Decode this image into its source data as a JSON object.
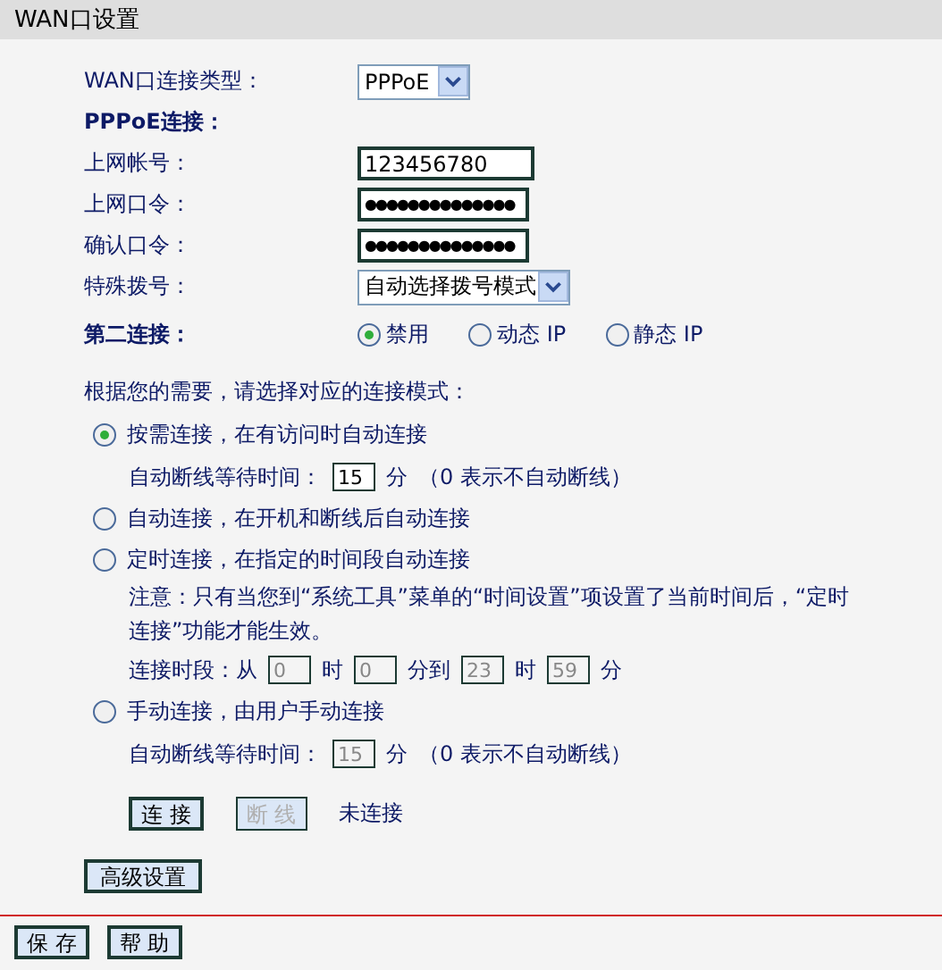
{
  "title": "WAN口设置",
  "fields": [
    {
      "kind": "select",
      "label": "WAN口连接类型：",
      "value": "PPPoE"
    },
    {
      "kind": "heading",
      "label": "PPPoE连接："
    },
    {
      "kind": "text",
      "label": "上网帐号：",
      "value": "123456780"
    },
    {
      "kind": "text",
      "label": "上网口令：",
      "value": "●●●●●●●●●●●●●●"
    },
    {
      "kind": "text",
      "label": "确认口令：",
      "value": "●●●●●●●●●●●●●●"
    },
    {
      "kind": "wideselect",
      "label": "特殊拨号：",
      "value": "自动选择拨号模式"
    }
  ],
  "second": {
    "label": "第二连接：",
    "options": [
      {
        "label": "禁用",
        "selected": true
      },
      {
        "label": "动态 IP",
        "selected": false
      },
      {
        "label": "静态 IP",
        "selected": false
      }
    ]
  },
  "prompt": "根据您的需要，请选择对应的连接模式：",
  "modes": [
    {
      "label": "按需连接，在有访问时自动连接",
      "selected": true,
      "details": [
        {
          "kind": "idle",
          "label": "自动断线等待时间：",
          "value": "15",
          "unit": "分",
          "note": "（0 表示不自动断线）",
          "disabled": false
        }
      ]
    },
    {
      "label": "自动连接，在开机和断线后自动连接",
      "selected": false
    },
    {
      "label": "定时连接，在指定的时间段自动连接",
      "selected": false,
      "details": [
        {
          "kind": "note",
          "text": "注意：只有当您到“系统工具”菜单的“时间设置”项设置了当前时间后，“定时连接”功能才能生效。"
        },
        {
          "kind": "period",
          "label": "连接时段：从",
          "parts": [
            {
              "value": "0",
              "unit": "时"
            },
            {
              "value": "0",
              "unit": "分到"
            },
            {
              "value": "23",
              "unit": "时"
            },
            {
              "value": "59",
              "unit": "分"
            }
          ],
          "disabled": true
        }
      ]
    },
    {
      "label": "手动连接，由用户手动连接",
      "selected": false,
      "details": [
        {
          "kind": "idle",
          "label": "自动断线等待时间：",
          "value": "15",
          "unit": "分",
          "note": "（0 表示不自动断线）",
          "disabled": true
        }
      ]
    }
  ],
  "actions": [
    {
      "label": "连 接",
      "disabled": false
    },
    {
      "label": "断 线",
      "disabled": true
    }
  ],
  "status": "未连接",
  "advanced": "高级设置",
  "footer": [
    "保 存",
    "帮 助"
  ]
}
